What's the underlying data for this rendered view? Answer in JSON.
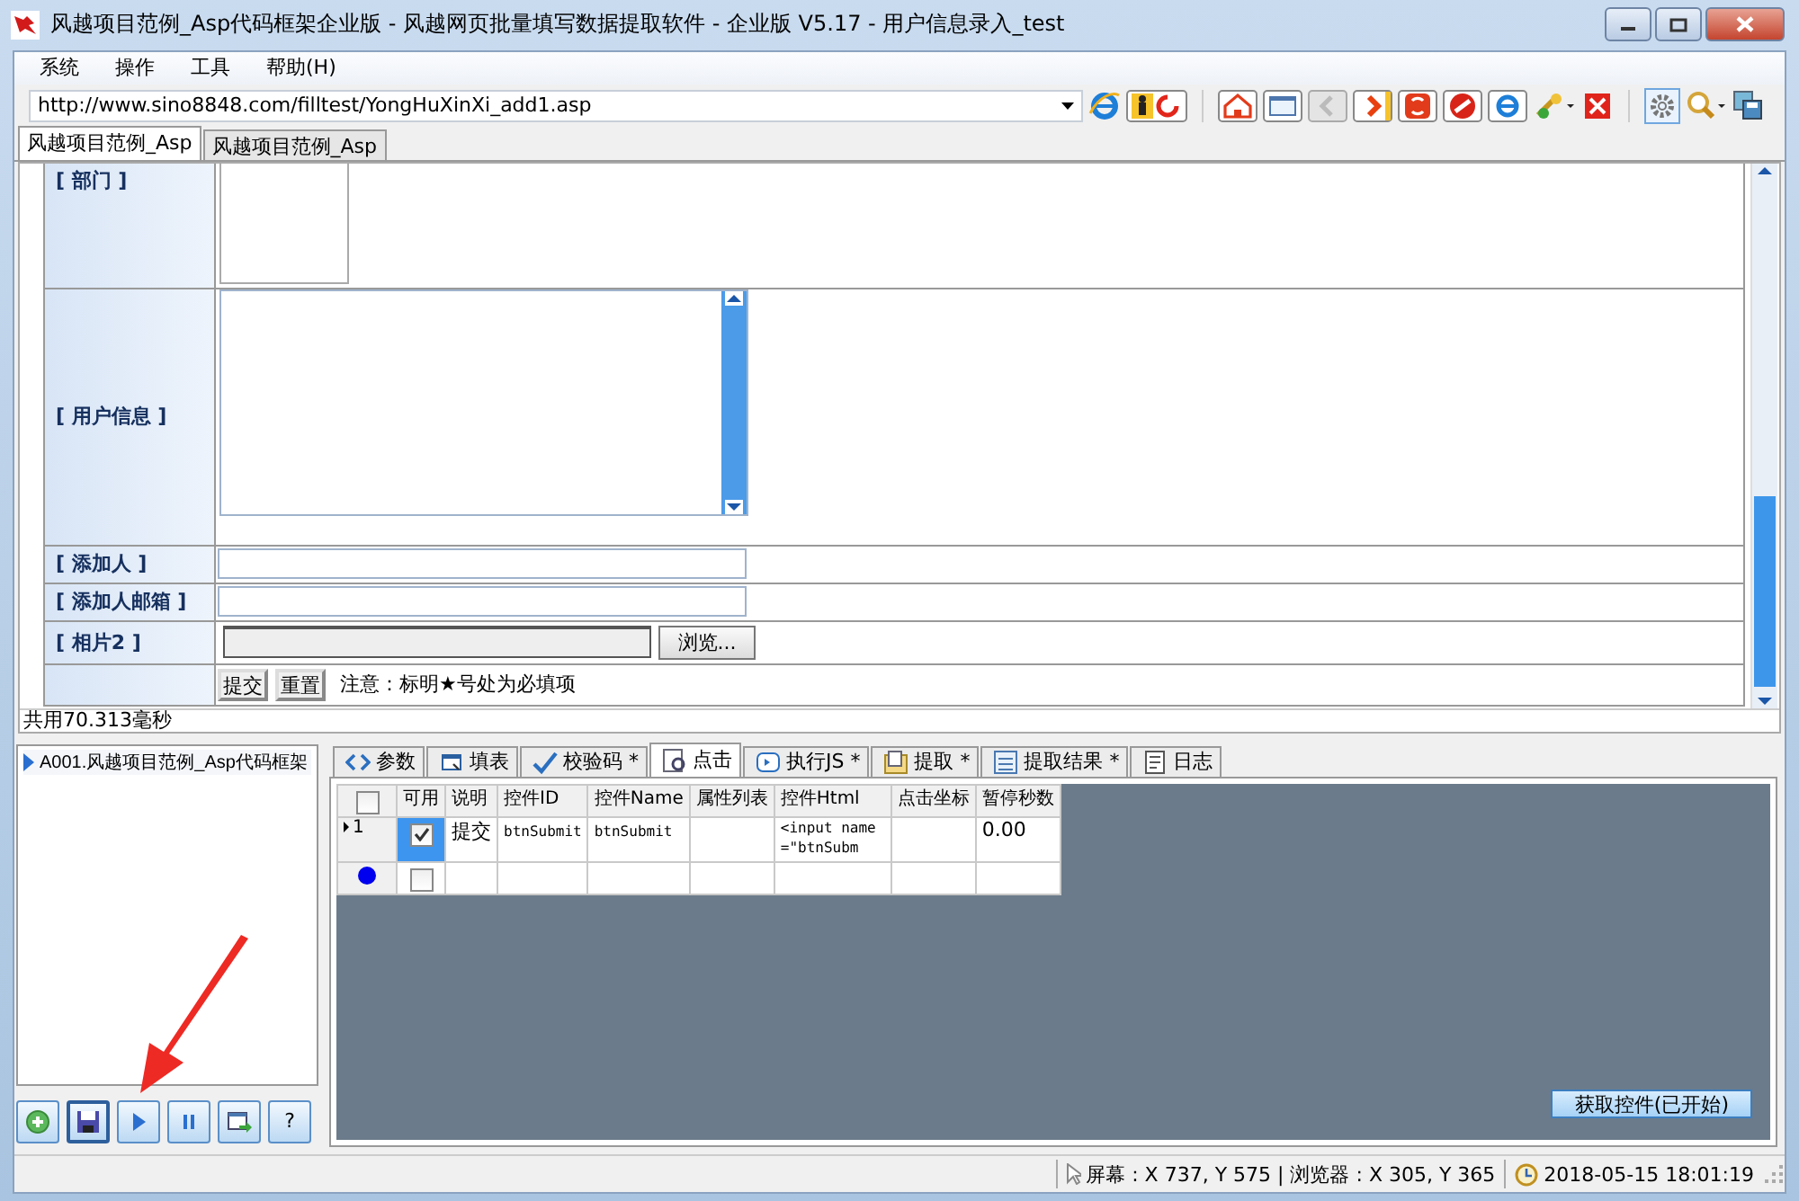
{
  "window": {
    "title": "风越项目范例_Asp代码框架企业版 - 风越网页批量填写数据提取软件 - 企业版 V5.17 - 用户信息录入_test"
  },
  "menu": [
    "系统",
    "操作",
    "工具",
    "帮助(H)"
  ],
  "address": {
    "value": "http://www.sino8848.com/filltest/YongHuXinXi_add1.asp"
  },
  "doc_tabs": [
    {
      "label": "风越项目范例_Asp",
      "selected": true
    },
    {
      "label": "风越项目范例_Asp",
      "selected": false
    }
  ],
  "form": {
    "rows": [
      {
        "kind": "memo-cut",
        "label": "[ 部门 ]"
      },
      {
        "kind": "memo",
        "label": "[ 用户信息 ]"
      },
      {
        "kind": "text",
        "label": "[ 添加人 ]"
      },
      {
        "kind": "text",
        "label": "[ 添加人邮箱 ]"
      },
      {
        "kind": "file",
        "label": "[ 相片2 ]",
        "button": "浏览..."
      }
    ],
    "buttons": [
      "提交",
      "重置"
    ],
    "note": "注意：标明★号处为必填项"
  },
  "timing": "共用70.313毫秒",
  "tree": [
    {
      "label": "A001.风越项目范例_Asp代码框架"
    }
  ],
  "panel_tabs": [
    {
      "label": "参数",
      "selected": false
    },
    {
      "label": "填表",
      "selected": false
    },
    {
      "label": "校验码 *",
      "selected": false
    },
    {
      "label": "点击",
      "selected": true
    },
    {
      "label": "执行JS *",
      "selected": false
    },
    {
      "label": "提取 *",
      "selected": false
    },
    {
      "label": "提取结果 *",
      "selected": false
    },
    {
      "label": "日志",
      "selected": false
    }
  ],
  "grid": {
    "all_checked": false,
    "columns": [
      "可用",
      "说明",
      "控件ID",
      "控件Name",
      "属性列表",
      "控件Html",
      "点击坐标",
      "暂停秒数"
    ],
    "rows": [
      {
        "kind": "current",
        "row_no": "1",
        "enabled": true,
        "note": "提交",
        "control_id": "btnSubmit",
        "control_name": "btnSubmit",
        "html": "<input name=\"btnSubm",
        "pause": "0.00"
      },
      {
        "kind": "new",
        "enabled": false
      }
    ]
  },
  "action_button": "获取控件(已开始)",
  "help_button": "?",
  "status": {
    "coords": "屏幕 : X 737, Y 575 | 浏览器 : X 305, Y 365",
    "datetime": "2018-05-15 18:01:19"
  }
}
